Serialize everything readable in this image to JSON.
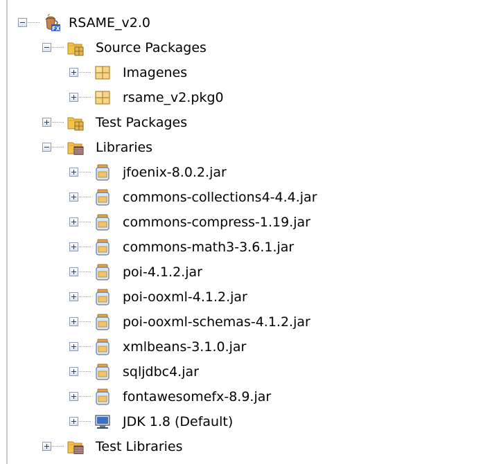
{
  "tree": {
    "project": {
      "label": "RSAME_v2.0",
      "icon": "javafx-project-icon"
    },
    "source_packages": {
      "label": "Source Packages",
      "icon": "source-folder-icon",
      "children": [
        {
          "label": "Imagenes",
          "icon": "package-icon"
        },
        {
          "label": "rsame_v2.pkg0",
          "icon": "package-icon"
        }
      ]
    },
    "test_packages": {
      "label": "Test Packages",
      "icon": "source-folder-icon"
    },
    "libraries": {
      "label": "Libraries",
      "icon": "library-folder-icon",
      "children": [
        {
          "label": "jfoenix-8.0.2.jar",
          "icon": "jar-icon"
        },
        {
          "label": "commons-collections4-4.4.jar",
          "icon": "jar-icon"
        },
        {
          "label": "commons-compress-1.19.jar",
          "icon": "jar-icon"
        },
        {
          "label": "commons-math3-3.6.1.jar",
          "icon": "jar-icon"
        },
        {
          "label": "poi-4.1.2.jar",
          "icon": "jar-icon"
        },
        {
          "label": "poi-ooxml-4.1.2.jar",
          "icon": "jar-icon"
        },
        {
          "label": "poi-ooxml-schemas-4.1.2.jar",
          "icon": "jar-icon"
        },
        {
          "label": "xmlbeans-3.1.0.jar",
          "icon": "jar-icon"
        },
        {
          "label": "sqljdbc4.jar",
          "icon": "jar-icon"
        },
        {
          "label": "fontawesomefx-8.9.jar",
          "icon": "jar-icon"
        },
        {
          "label": "JDK 1.8 (Default)",
          "icon": "jdk-platform-icon"
        }
      ]
    },
    "test_libraries": {
      "label": "Test Libraries",
      "icon": "library-folder-icon"
    }
  }
}
